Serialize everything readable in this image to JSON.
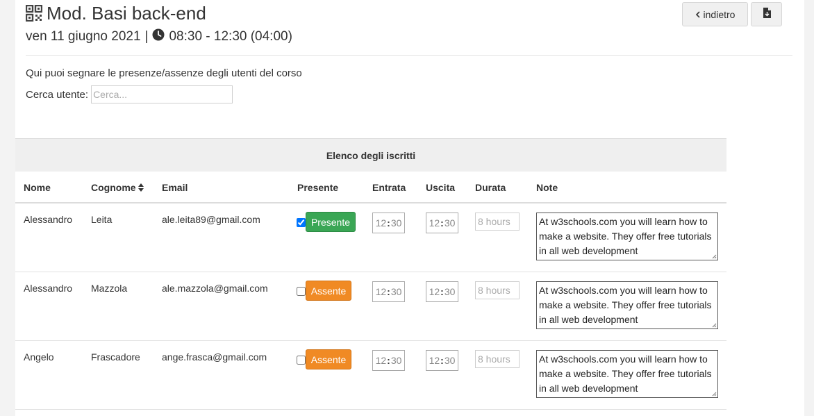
{
  "header": {
    "title": "Mod. Basi back-end",
    "date": "ven 11 giugno 2021",
    "separator": "|",
    "time": "08:30 - 12:30 (04:00)",
    "back_label": "indietro"
  },
  "intro_text": "Qui puoi segnare le presenze/assenze degli utenti del corso",
  "search": {
    "label": "Cerca utente:",
    "placeholder": "Cerca..."
  },
  "table": {
    "caption": "Elenco degli iscritti",
    "headers": {
      "nome": "Nome",
      "cognome": "Cognome",
      "email": "Email",
      "presente": "Presente",
      "entrata": "Entrata",
      "uscita": "Uscita",
      "durata": "Durata",
      "note": "Note"
    },
    "rows": [
      {
        "nome": "Alessandro",
        "cognome": "Leita",
        "email": "ale.leita89@gmail.com",
        "checked": true,
        "status": "Presente",
        "entrata_h": "12",
        "entrata_m": "30",
        "uscita_h": "12",
        "uscita_m": "30",
        "durata_placeholder": "8 hours",
        "note": "At w3schools.com you will learn how to make a website. They offer free tutorials in all web development"
      },
      {
        "nome": "Alessandro",
        "cognome": "Mazzola",
        "email": "ale.mazzola@gmail.com",
        "checked": false,
        "status": "Assente",
        "entrata_h": "12",
        "entrata_m": "30",
        "uscita_h": "12",
        "uscita_m": "30",
        "durata_placeholder": "8 hours",
        "note": "At w3schools.com you will learn how to make a website. They offer free tutorials in all web development"
      },
      {
        "nome": "Angelo",
        "cognome": "Frascadore",
        "email": "ange.frasca@gmail.com",
        "checked": false,
        "status": "Assente",
        "entrata_h": "12",
        "entrata_m": "30",
        "uscita_h": "12",
        "uscita_m": "30",
        "durata_placeholder": "8 hours",
        "note": "At w3schools.com you will learn how to make a website. They offer free tutorials in all web development"
      }
    ]
  },
  "colors": {
    "present": "#3aa655",
    "absent": "#f08a24"
  }
}
